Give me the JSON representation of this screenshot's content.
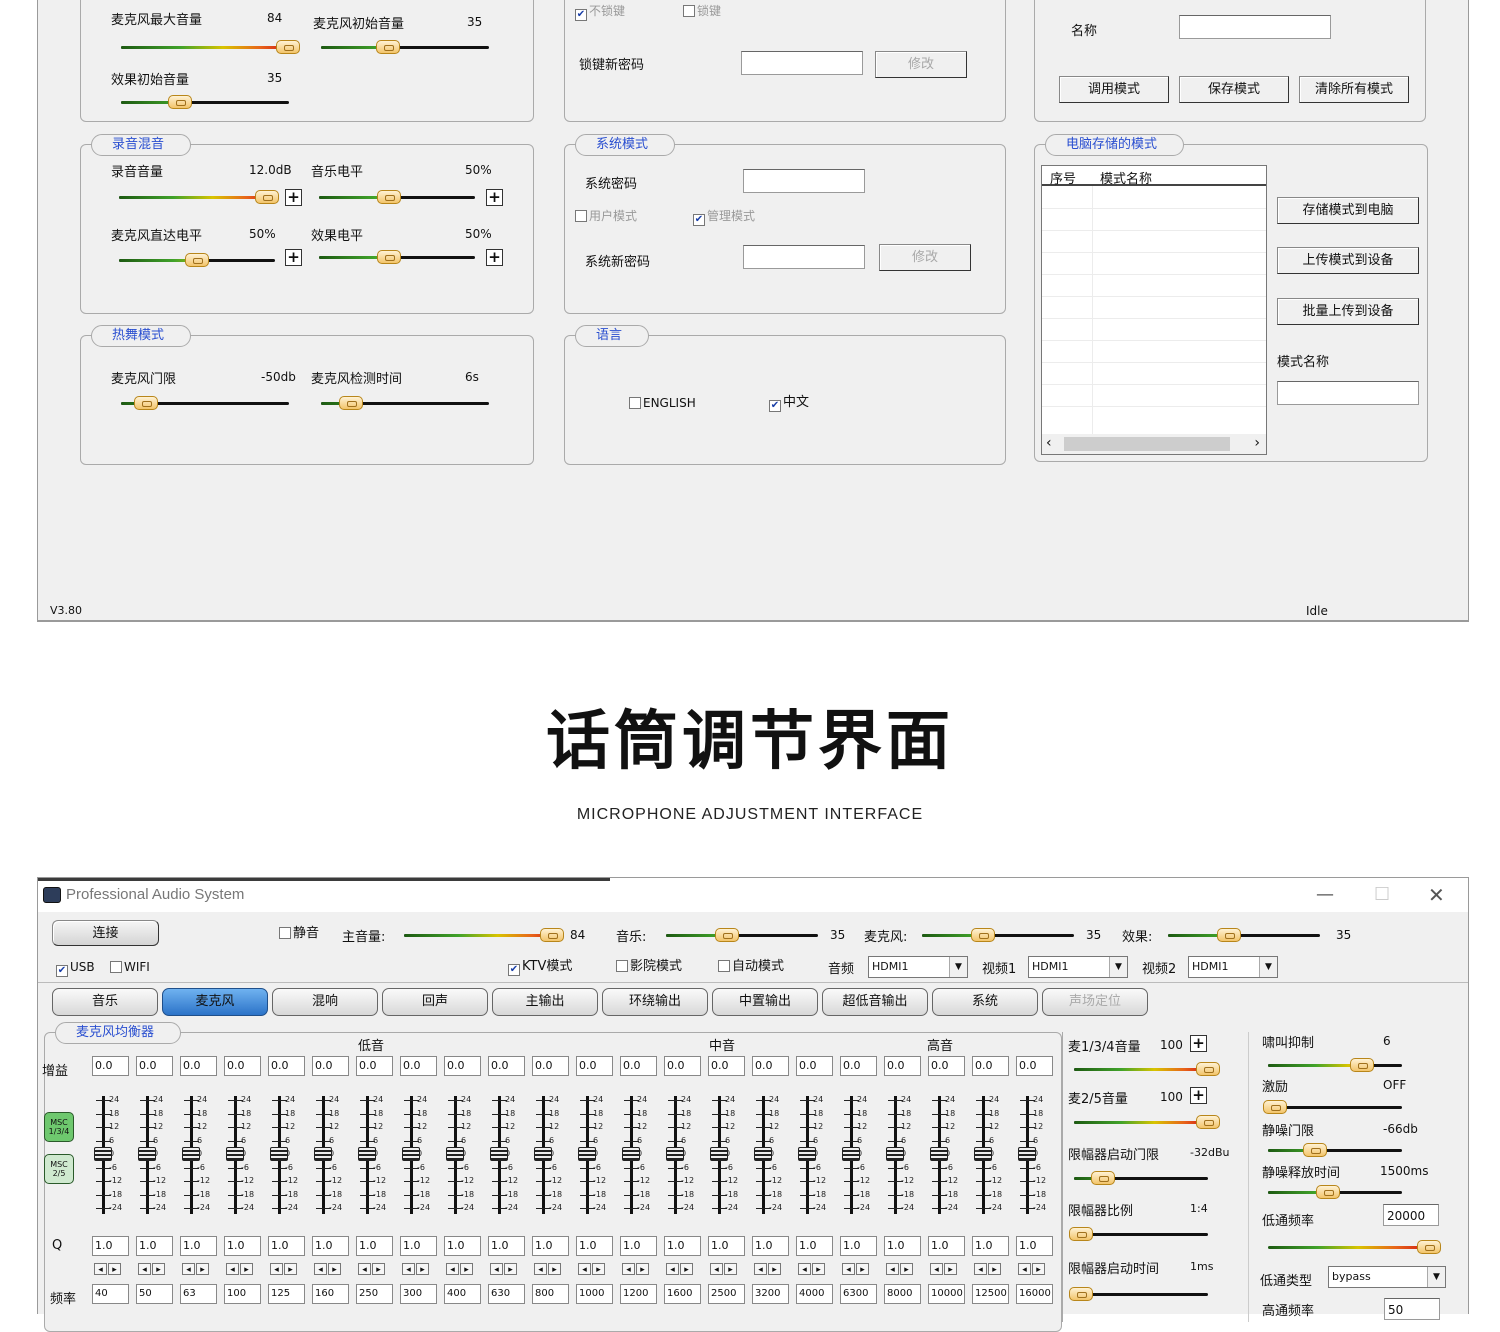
{
  "top_window": {
    "mic_group": {
      "mic_max_label": "麦克风最大音量",
      "mic_max_value": "84",
      "mic_max_level": 0.98,
      "mic_init_label": "麦克风初始音量",
      "mic_init_value": "35",
      "mic_init_level": 0.4,
      "effect_init_label": "效果初始音量",
      "effect_init_value": "35",
      "effect_init_level": 0.35
    },
    "lock_group": {
      "no_lock": "不锁键",
      "lock": "锁键",
      "new_pwd_label": "锁键新密码",
      "modify": "修改"
    },
    "mode_group": {
      "name_label": "名称",
      "load_mode": "调用模式",
      "save_mode": "保存模式",
      "clear_modes": "清除所有模式"
    },
    "rec_group": {
      "caption": "录音混音",
      "rec_vol_label": "录音音量",
      "rec_vol_value": "12.0dB",
      "rec_vol_level": 0.95,
      "music_level_label": "音乐电平",
      "music_level_value": "50%",
      "music_level": 0.45,
      "mic_direct_label": "麦克风直达电平",
      "mic_direct_value": "50%",
      "mic_direct_level": 0.5,
      "effect_level_label": "效果电平",
      "effect_level_value": "50%",
      "effect_level": 0.45
    },
    "sys_group": {
      "caption": "系统模式",
      "pwd_label": "系统密码",
      "user_mode": "用户模式",
      "admin_mode": "管理模式",
      "new_pwd_label": "系统新密码",
      "modify": "修改"
    },
    "pc_group": {
      "caption": "电脑存储的模式",
      "col_no": "序号",
      "col_name": "模式名称",
      "store_to_pc": "存储模式到电脑",
      "upload_to_dev": "上传模式到设备",
      "batch_upload": "批量上传到设备",
      "mode_name_label": "模式名称"
    },
    "dance_group": {
      "caption": "热舞模式",
      "gate_label": "麦克风门限",
      "gate_value": "-50db",
      "gate_level": 0.15,
      "detect_label": "麦克风检测时间",
      "detect_value": "6s",
      "detect_level": 0.18
    },
    "lang_group": {
      "caption": "语言",
      "english": "ENGLISH",
      "chinese": "中文"
    },
    "status": {
      "version": "V3.80",
      "state": "Idle"
    }
  },
  "heading": {
    "cn": "话筒调节界面",
    "en": "MICROPHONE ADJUSTMENT INTERFACE"
  },
  "bottom_window": {
    "title": "Professional Audio System",
    "connect": "连接",
    "mute": "静音",
    "master_label": "主音量:",
    "master_value": "84",
    "master_level": 0.95,
    "music_label": "音乐:",
    "music_value": "35",
    "music_level": 0.4,
    "mic_label": "麦克风:",
    "mic_value": "35",
    "mic_level": 0.4,
    "effect_label": "效果:",
    "effect_value": "35",
    "effect_level": 0.4,
    "usb": "USB",
    "wifi": "WIFI",
    "ktv_mode": "KTV模式",
    "cinema_mode": "影院模式",
    "auto_mode": "自动模式",
    "audio_label": "音频",
    "audio_value": "HDMI1",
    "video1_label": "视频1",
    "video1_value": "HDMI1",
    "video2_label": "视频2",
    "video2_value": "HDMI1",
    "tabs": [
      "音乐",
      "麦克风",
      "混响",
      "回声",
      "主输出",
      "环绕输出",
      "中置输出",
      "超低音输出",
      "系统",
      "声场定位"
    ],
    "eq": {
      "caption": "麦克风均衡器",
      "band_low": "低音",
      "band_mid": "中音",
      "band_high": "高音",
      "gain_label": "增益",
      "q_label": "Q",
      "freq_label": "频率",
      "msc1": "MSC 1/3/4",
      "msc2": "MSC 2/5",
      "ticks": [
        "24",
        "18",
        "12",
        "6",
        "0",
        "-6",
        "-12",
        "-18",
        "-24"
      ],
      "gains": [
        "0.0",
        "0.0",
        "0.0",
        "0.0",
        "0.0",
        "0.0",
        "0.0",
        "0.0",
        "0.0",
        "0.0",
        "0.0",
        "0.0",
        "0.0",
        "0.0",
        "0.0",
        "0.0",
        "0.0",
        "0.0",
        "0.0",
        "0.0",
        "0.0",
        "0.0"
      ],
      "qs": [
        "1.0",
        "1.0",
        "1.0",
        "1.0",
        "1.0",
        "1.0",
        "1.0",
        "1.0",
        "1.0",
        "1.0",
        "1.0",
        "1.0",
        "1.0",
        "1.0",
        "1.0",
        "1.0",
        "1.0",
        "1.0",
        "1.0",
        "1.0",
        "1.0",
        "1.0"
      ],
      "freqs": [
        "40",
        "50",
        "63",
        "100",
        "125",
        "160",
        "250",
        "300",
        "400",
        "630",
        "800",
        "1000",
        "1200",
        "1600",
        "2500",
        "3200",
        "4000",
        "6300",
        "8000",
        "10000",
        "12500",
        "16000"
      ]
    },
    "right1": {
      "mic134_label": "麦1/3/4音量",
      "mic134_value": "100",
      "mic134_level": 1.0,
      "mic25_label": "麦2/5音量",
      "mic25_value": "100",
      "mic25_level": 1.0,
      "limit_thr_label": "限幅器启动门限",
      "limit_thr_value": "-32dBu",
      "limit_thr_level": 0.22,
      "limit_ratio_label": "限幅器比例",
      "limit_ratio_value": "1:4",
      "limit_ratio_level": 0.05,
      "limit_time_label": "限幅器启动时间",
      "limit_time_value": "1ms",
      "limit_time_level": 0.05
    },
    "right2": {
      "howl_label": "啸叫抑制",
      "howl_value": "6",
      "howl_level": 0.7,
      "excite_label": "激励",
      "excite_value": "OFF",
      "excite_level": 0.05,
      "gate_label": "静噪门限",
      "gate_value": "-66db",
      "gate_level": 0.35,
      "release_label": "静噪释放时间",
      "release_value": "1500ms",
      "release_level": 0.45,
      "lp_freq_label": "低通频率",
      "lp_freq_value": "20000",
      "lp_level": 0.98,
      "lp_type_label": "低通类型",
      "lp_type_value": "bypass",
      "hp_freq_label": "高通频率",
      "hp_freq_value": "50"
    }
  }
}
